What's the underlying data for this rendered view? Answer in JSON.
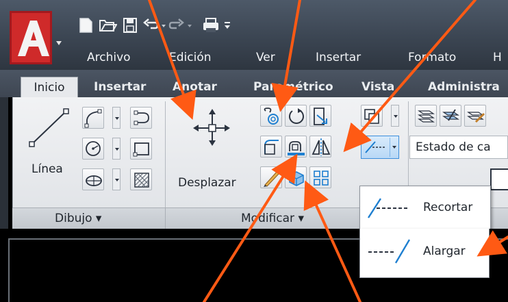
{
  "menu": {
    "items": [
      "Archivo",
      "Edición",
      "Ver",
      "Insertar",
      "Formato",
      "H"
    ]
  },
  "ribbon": {
    "tabs": [
      "Inicio",
      "Insertar",
      "Anotar",
      "Paramétrico",
      "Vista",
      "Administra"
    ],
    "active_tab": "Inicio"
  },
  "dibujo": {
    "title": "Dibujo ▾",
    "linea_label": "Línea"
  },
  "modificar": {
    "title": "Modificar ▾",
    "desplazar_label": "Desplazar"
  },
  "capas": {
    "estado_label": "Estado de ca"
  },
  "flyout": {
    "recortar": "Recortar",
    "alargar": "Alargar"
  },
  "colors": {
    "arrow": "#ff5a14",
    "logo_red": "#d22b2b",
    "ribbon_bg": "#e8eaed"
  }
}
